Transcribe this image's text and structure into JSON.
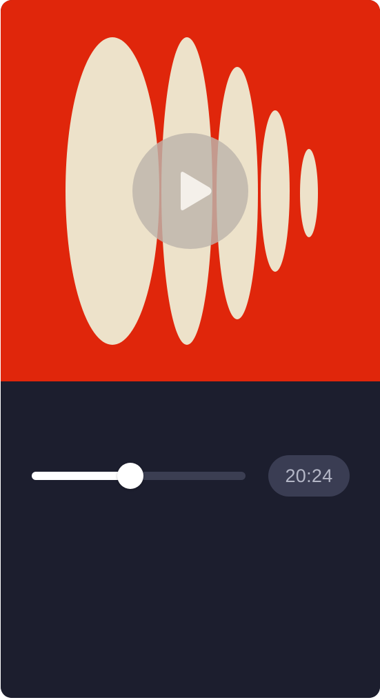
{
  "artwork": {
    "name": "sound-wave-artwork",
    "background_color": "#e0260b",
    "wave_color": "#ede2ca"
  },
  "play_button": {
    "icon": "play-icon",
    "circle_color": "#bdb5ab",
    "icon_color": "#f4f0ea"
  },
  "player": {
    "background_color": "#1c1e2e",
    "progress_fraction": 0.46,
    "progress_fill_color": "#ffffff",
    "progress_rail_color": "#3b3e52",
    "time_label": "20:24",
    "time_badge_color": "#3a3d53",
    "time_text_color": "#b3b6c6"
  }
}
